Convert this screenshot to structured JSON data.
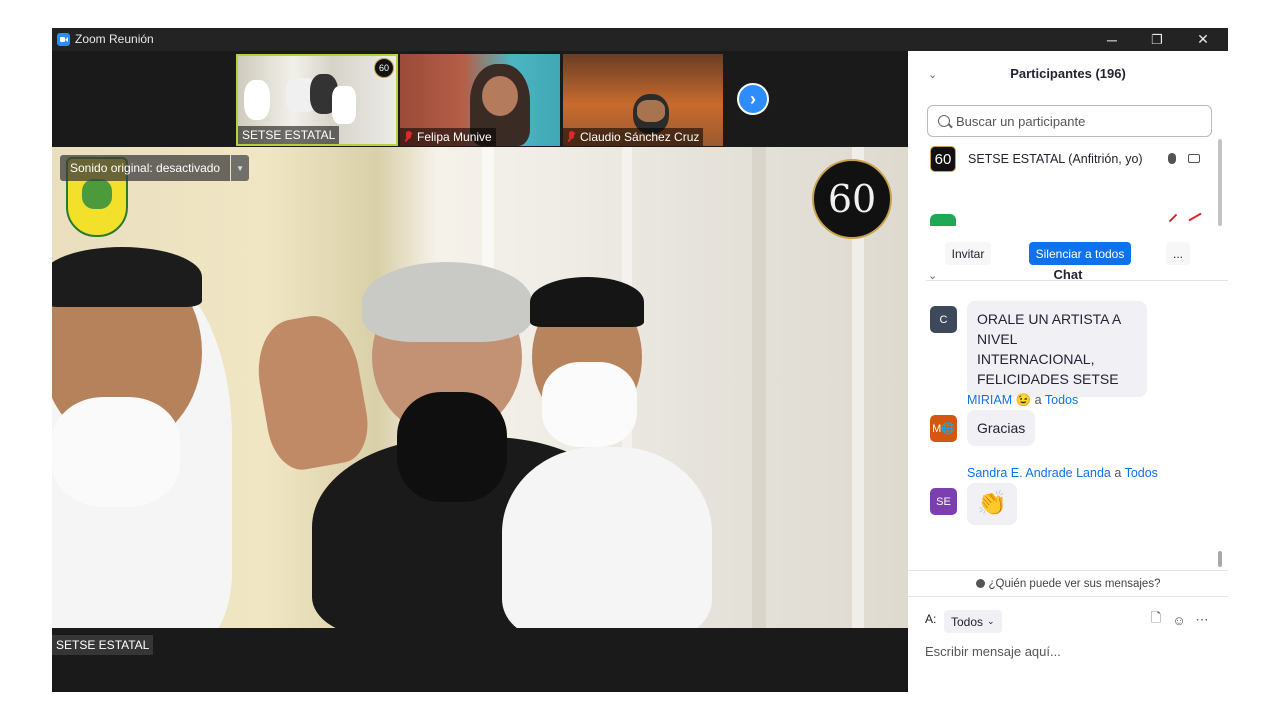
{
  "window": {
    "title": "Zoom Reunión",
    "minimize": "─",
    "restore": "❐",
    "close": "✕"
  },
  "thumbnails": [
    {
      "name": "SETSE ESTATAL",
      "muted": false
    },
    {
      "name": "Felipa Munive",
      "muted": true
    },
    {
      "name": "Claudio Sánchez Cruz",
      "muted": true
    }
  ],
  "next_arrow": "›",
  "main_video": {
    "original_sound": "Sonido original: desactivado",
    "dropdown_arrow": "▼",
    "logo_text": "60",
    "speaker_name": "SETSE ESTATAL"
  },
  "participants": {
    "title": "Participantes (196)",
    "search_placeholder": "Buscar un participante",
    "list": [
      {
        "name": "SETSE ESTATAL (Anfitrión, yo)",
        "avatar_text": "60"
      }
    ],
    "invite_label": "Invitar",
    "mute_all_label": "Silenciar a todos",
    "more_label": "..."
  },
  "chat": {
    "title": "Chat",
    "messages": [
      {
        "avatar": "C",
        "avatar_color": "#3c4a5c",
        "sender": "",
        "to": "",
        "text": "ORALE UN ARTISTA A NIVEL INTERNACIONAL, FELICIDADES SETSE"
      },
      {
        "avatar": "M🌐",
        "avatar_color": "#d4570f",
        "sender": "MIRIAM 😉",
        "a": "a",
        "to": "Todos",
        "text": "Gracias"
      },
      {
        "avatar": "SE",
        "avatar_color": "#7b3fb0",
        "sender": "Sandra E. Andrade Landa",
        "a": "a",
        "to": "Todos",
        "text": "👏"
      }
    ],
    "who_can_see": "¿Quién puede ver sus mensajes?",
    "recipient_label": "A:",
    "recipient_value": "Todos",
    "input_placeholder": "Escribir mensaje aquí..."
  },
  "colors": {
    "accent": "#0e72ed",
    "zoom_blue": "#2d8cff",
    "mute_red": "#e02828"
  }
}
